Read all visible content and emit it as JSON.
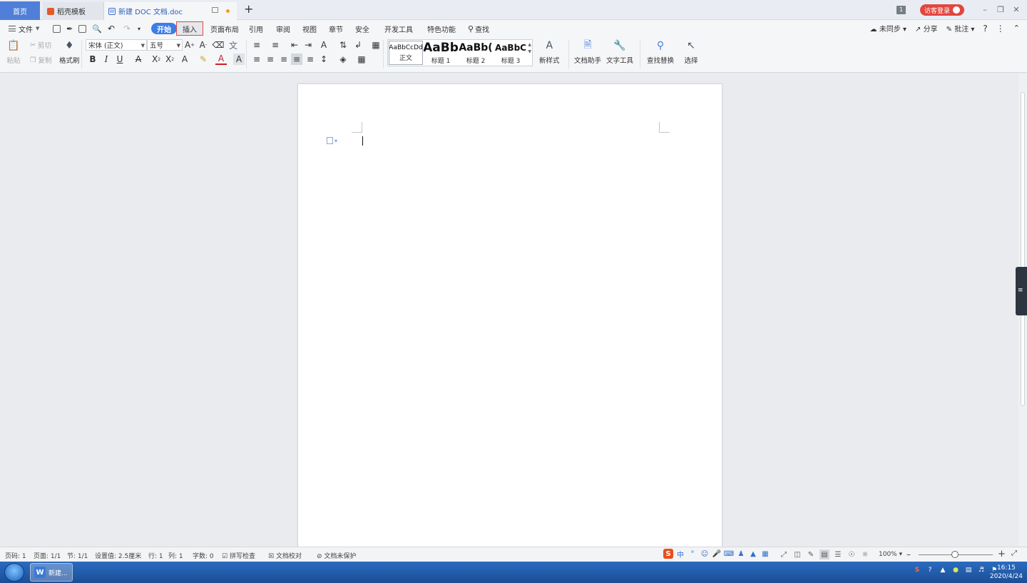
{
  "titlebar": {
    "home_tab": "首页",
    "template_tab": "稻壳模板",
    "doc_tab": "新建 DOC 文档.doc",
    "new_tab_symbol": "+",
    "window_count": "1",
    "login": "访客登录"
  },
  "menu": {
    "file": "文件",
    "tabs": [
      "开始",
      "插入",
      "页面布局",
      "引用",
      "审阅",
      "视图",
      "章节",
      "安全",
      "开发工具",
      "特色功能"
    ],
    "search": "查找",
    "sync": "未同步",
    "share": "分享",
    "comment": "批注"
  },
  "ribbon": {
    "paste": "粘贴",
    "cut": "剪切",
    "copy": "复制",
    "format_painter": "格式刷",
    "font_name": "宋体 (正文)",
    "font_size": "五号",
    "styles": [
      {
        "sample": "AaBbCcDd",
        "caption": "正文"
      },
      {
        "sample": "AaBb",
        "caption": "标题 1"
      },
      {
        "sample": "AaBb(",
        "caption": "标题 2"
      },
      {
        "sample": "AaBbC",
        "caption": "标题 3"
      }
    ],
    "new_style": "新样式",
    "doc_assistant": "文档助手",
    "text_tools": "文字工具",
    "find_replace": "查找替换",
    "select": "选择"
  },
  "status": {
    "page_code": "页码: 1",
    "pages": "页面: 1/1",
    "section": "节: 1/1",
    "setting": "设置值: 2.5厘米",
    "row": "行: 1",
    "col": "列: 1",
    "words": "字数: 0",
    "spell": "拼写检查",
    "proof": "文档校对",
    "protect": "文档未保护",
    "zoom": "100%"
  },
  "taskbar": {
    "task_label": "新建...",
    "time": "16:15",
    "date": "2020/4/24"
  },
  "colors": {
    "accent_blue": "#3c7ee6",
    "home_tab": "#4f7fd8",
    "login_red": "#e0473f",
    "taskbar": "#1c4e96"
  }
}
